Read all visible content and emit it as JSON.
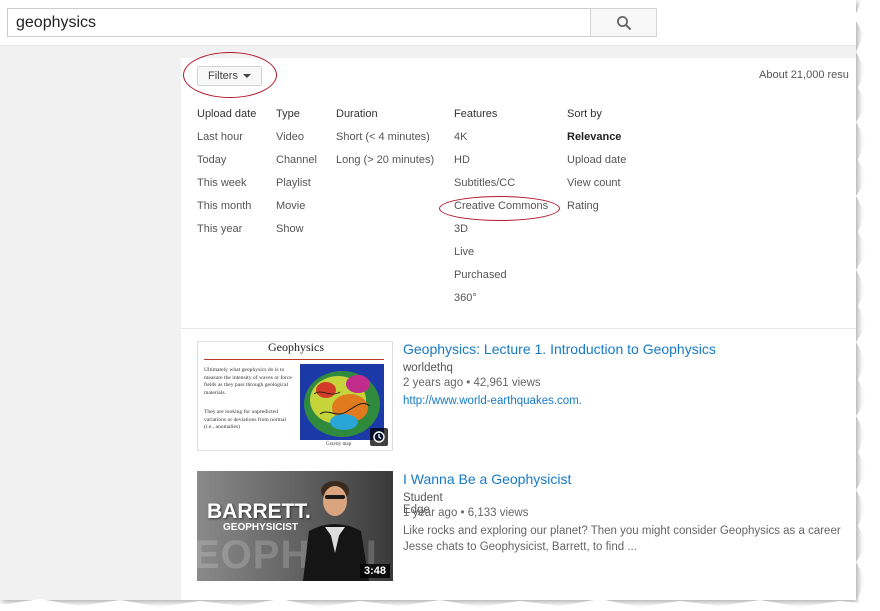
{
  "search": {
    "query": "geophysics"
  },
  "filters": {
    "button_label": "Filters",
    "results_count": "About 21,000 resu",
    "columns": [
      {
        "header": "Upload date",
        "options": [
          "Last hour",
          "Today",
          "This week",
          "This month",
          "This year"
        ]
      },
      {
        "header": "Type",
        "options": [
          "Video",
          "Channel",
          "Playlist",
          "Movie",
          "Show"
        ]
      },
      {
        "header": "Duration",
        "options": [
          "Short (< 4 minutes)",
          "Long (> 20 minutes)"
        ]
      },
      {
        "header": "Features",
        "options": [
          "4K",
          "HD",
          "Subtitles/CC",
          "Creative Commons",
          "3D",
          "Live",
          "Purchased",
          "360°"
        ]
      },
      {
        "header": "Sort by",
        "options": [
          "Relevance",
          "Upload date",
          "View count",
          "Rating"
        ],
        "selected": "Relevance"
      }
    ]
  },
  "results": [
    {
      "title": "Geophysics: Lecture 1. Introduction to Geophysics",
      "channel": "worldethq",
      "meta": "2 years ago • 42,961 views",
      "desc_link": "http://www.world-earthquakes.com.",
      "thumb": {
        "slide_title": "Geophysics",
        "slide_text_1": "Ultimately what geophysics do is to measure the intensity of waves or force fields as they pass through geological materials.",
        "slide_text_2": "They are looking for unpredicted variations or deviations from normal (i.e., anomalies)",
        "caption": "Gravity map"
      }
    },
    {
      "title": "I Wanna Be a Geophysicist",
      "channel": "Student Edge",
      "meta": "1 year ago • 6,133 views",
      "desc_line1": "Like rocks and exploring our planet? Then you might consider Geophysics as a career",
      "desc_line2": "Jesse chats to Geophysicist, Barrett, to find ...",
      "duration": "3:48",
      "thumb": {
        "name_text": "BARRETT.",
        "role_text": "GEOPHYSICIST",
        "bg_text": "EOPHYSI"
      }
    }
  ],
  "colors": {
    "accent_red": "#b2182b",
    "link_blue": "#167ac6"
  },
  "icons": [
    "search-icon",
    "caret-down-icon",
    "clock-icon"
  ]
}
